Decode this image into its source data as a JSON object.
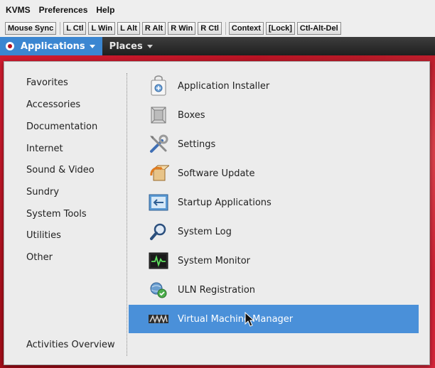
{
  "menubar": {
    "items": [
      "KVMS",
      "Preferences",
      "Help"
    ]
  },
  "toolbar": {
    "mouse_sync": "Mouse Sync",
    "keys": [
      "L Ctl",
      "L Win",
      "L Alt",
      "R Alt",
      "R Win",
      "R Ctl"
    ],
    "context": "Context",
    "lock": "[Lock]",
    "cad": "Ctl-Alt-Del"
  },
  "panel": {
    "applications": "Applications",
    "places": "Places"
  },
  "menu": {
    "categories": [
      "Favorites",
      "Accessories",
      "Documentation",
      "Internet",
      "Sound & Video",
      "Sundry",
      "System Tools",
      "Utilities",
      "Other"
    ],
    "activities": "Activities Overview",
    "apps": [
      {
        "label": "Application Installer",
        "icon": "application-installer-icon"
      },
      {
        "label": "Boxes",
        "icon": "boxes-icon"
      },
      {
        "label": "Settings",
        "icon": "settings-icon"
      },
      {
        "label": "Software Update",
        "icon": "software-update-icon"
      },
      {
        "label": "Startup Applications",
        "icon": "startup-applications-icon"
      },
      {
        "label": "System Log",
        "icon": "system-log-icon"
      },
      {
        "label": "System Monitor",
        "icon": "system-monitor-icon"
      },
      {
        "label": "ULN Registration",
        "icon": "uln-registration-icon"
      },
      {
        "label": "Virtual Machine Manager",
        "icon": "virtual-machine-manager-icon"
      }
    ],
    "selected": "Virtual Machine Manager"
  },
  "colors": {
    "accent": "#4a90d9",
    "wallpaper": "#c8162a",
    "panel": "#2a2a2a"
  }
}
